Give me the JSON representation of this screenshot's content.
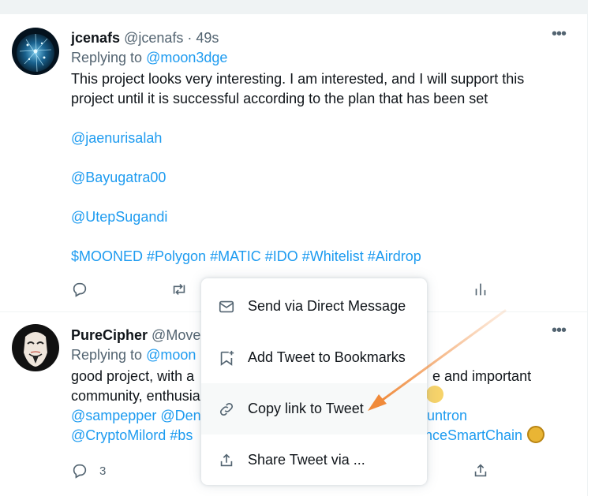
{
  "tweets": [
    {
      "name": "jcenafs",
      "handle": "@jcenafs",
      "separator": "·",
      "time": "49s",
      "replying_prefix": "Replying to",
      "replying_to": "@moon3dge",
      "body_line": "This project looks very interesting. I am interested, and I will support this project until it is successful according to the plan that has been set",
      "mentions": [
        "@jaenurisalah",
        "@Bayugatra00",
        "@UtepSugandi"
      ],
      "hashtags": "$MOONED #Polygon #MATIC  #IDO #Whitelist #Airdrop",
      "avatar_icon": "network-globe-avatar"
    },
    {
      "name": "PureCipher",
      "handle": "@Move",
      "replying_prefix": "Replying to",
      "replying_to": "@moon",
      "line1_left": "good project, with a",
      "line1_right": "e and important",
      "line2_left": "community, enthusia",
      "line3_left": "@sampepper @Den",
      "line3_right": "nsuntron",
      "line4_left": "@CryptoMilord #bs",
      "line4_right": "nceSmartChain",
      "reply_count": "3",
      "avatar_icon": "mask-avatar"
    }
  ],
  "menu": {
    "items": [
      {
        "label": "Send via Direct Message",
        "icon": "envelope-icon"
      },
      {
        "label": "Add Tweet to Bookmarks",
        "icon": "bookmark-plus-icon"
      },
      {
        "label": "Copy link to Tweet",
        "icon": "link-icon"
      },
      {
        "label": "Share Tweet via ...",
        "icon": "share-icon"
      }
    ]
  },
  "colors": {
    "accent": "#1d9bf0",
    "muted": "#536471",
    "annotation_arrow": "#f08a3a"
  }
}
